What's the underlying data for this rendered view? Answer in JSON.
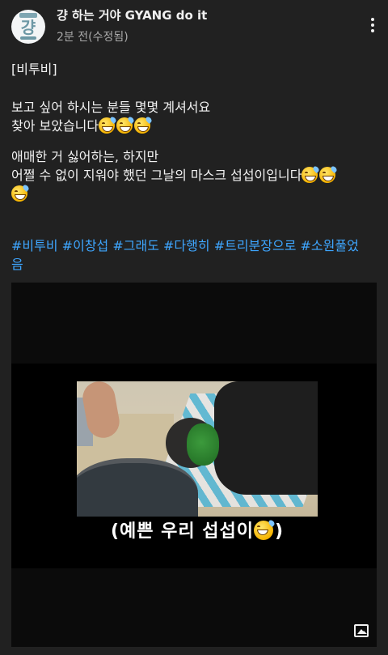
{
  "header": {
    "avatar_icon": "channel-logo-gyang",
    "channel_name": "걍 하는 거야 GYANG do it",
    "meta": "2분 전(수정됨)",
    "menu_icon": "more-vert-icon"
  },
  "post": {
    "line1": "[비투비]",
    "line2": "보고 싶어 하시는 분들 몇몇 계셔서요",
    "line3": "찾아 보았습니다",
    "line4": "애매한 거 싫어하는, 하지만",
    "line5": "어쩔 수 없이 지워야 했던 그날의 마스크 섭섭이입니다",
    "emoji": "grinning-face-with-sweat",
    "hashtags_line1": [
      "#비투비",
      "#이창섭",
      "#그래도",
      "#다행히",
      "#트리분장으로",
      "#소원풀었"
    ],
    "hashtags_line2": "음"
  },
  "media": {
    "caption": "(예쁜 우리 섭섭이",
    "caption_end": ")",
    "image_icon": "image-icon"
  },
  "colors": {
    "background": "#212121",
    "text": "#f1f1f1",
    "secondary": "#aaaaaa",
    "link": "#3ea6ff"
  }
}
